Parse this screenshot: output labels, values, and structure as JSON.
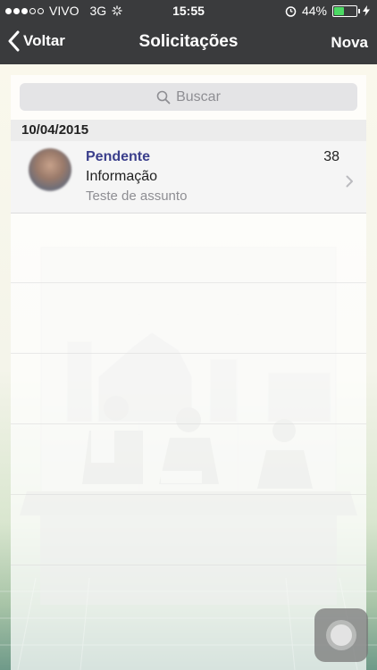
{
  "status_bar": {
    "carrier": "VIVO",
    "network": "3G",
    "time": "15:55",
    "battery": "44%",
    "battery_level": 0.44
  },
  "nav": {
    "back_label": "Voltar",
    "title": "Solicitações",
    "action_label": "Nova"
  },
  "search": {
    "placeholder": "Buscar"
  },
  "sections": [
    {
      "date": "10/04/2015",
      "items": [
        {
          "status": "Pendente",
          "number": "38",
          "type": "Informação",
          "subject": "Teste de assunto"
        }
      ]
    }
  ]
}
